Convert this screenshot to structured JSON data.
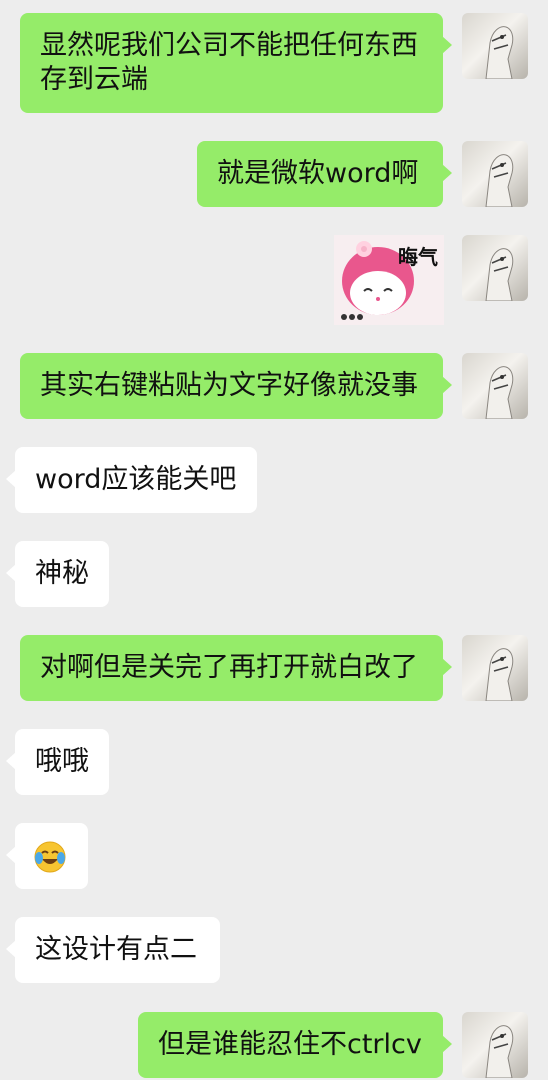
{
  "messages": [
    {
      "sender": "me",
      "text": "显然呢我们公司不能把任何东西存到云端"
    },
    {
      "sender": "me",
      "text": "就是微软word啊"
    },
    {
      "sender": "me",
      "type": "sticker",
      "text": "晦气"
    },
    {
      "sender": "me",
      "text": "其实右键粘贴为文字好像就没事"
    },
    {
      "sender": "them",
      "text": "word应该能关吧"
    },
    {
      "sender": "them",
      "text": "神秘"
    },
    {
      "sender": "me",
      "text": "对啊但是关完了再打开就白改了"
    },
    {
      "sender": "them",
      "text": "哦哦"
    },
    {
      "sender": "them",
      "type": "emoji",
      "icon": "laugh-cry-emoji"
    },
    {
      "sender": "them",
      "text": "这设计有点二"
    },
    {
      "sender": "me",
      "text": "但是谁能忍住不ctrlcv"
    }
  ],
  "colors": {
    "background": "#ededed",
    "my_bubble": "#95ec69",
    "their_bubble": "#ffffff"
  }
}
